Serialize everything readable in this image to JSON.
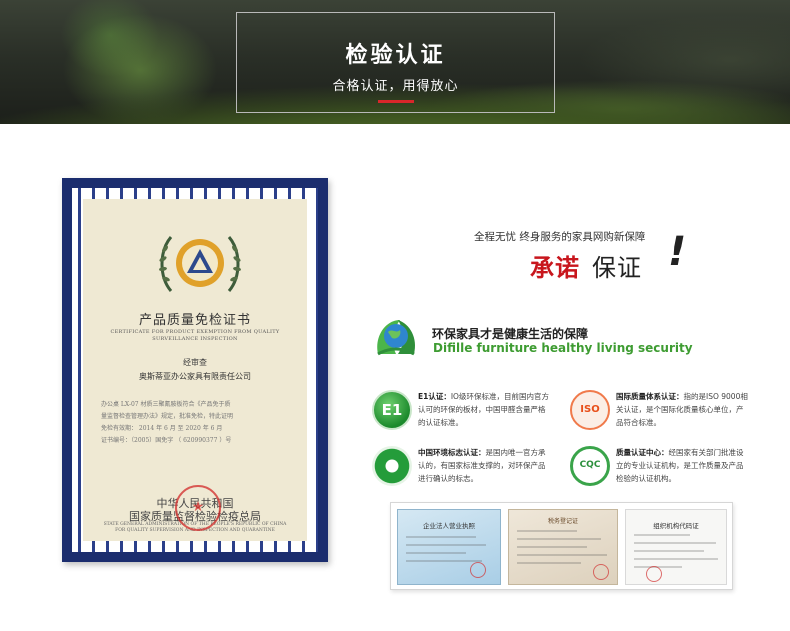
{
  "banner": {
    "title": "检验认证",
    "subtitle": "合格认证，用得放心"
  },
  "certificate": {
    "title": "产品质量免检证书",
    "subtitle_en": "CERTIFICATE FOR PRODUCT EXEMPTION FROM QUALITY SURVEILLANCE INSPECTION",
    "review_label": "经审查",
    "company": "奥斯蒂亚办公家具有限责任公司",
    "body_line1": "办公桌 LX-07 材质三聚氰胺板符合《产品免于质",
    "body_line2": "量监督检查管理办法》规定，批准免检，特此证明",
    "validity": "免检有效期：  2014 年  6 月  至 2020 年  6 月",
    "cert_no": "证书编号：（2005）国免字 （ 620990377 ）号",
    "issuer_cn_1": "中华人民共和国",
    "issuer_cn_2": "国家质量监督检验检疫总局",
    "issuer_en": "STATE GENERAL ADMINISTRATION OF THE PEOPLE'S REPUBLIC OF CHINA FOR QUALITY SUPERVISION AND INSPECTION AND QUARANTINE"
  },
  "promise": {
    "tagline": "全程无忧 终身服务的家具网购新保障",
    "red": "承诺",
    "black": "保证",
    "bang": "!"
  },
  "eco": {
    "cn": "环保家具才是健康生活的保障",
    "en": "Difille  furniture healthy living security"
  },
  "certs": [
    {
      "logo": "E1",
      "icon": "e1-logo-icon",
      "head": "E1认证：",
      "text": "IO级环保标准，目前国内官方认可的环保的板材，中国甲醛含量严格的认证标准。"
    },
    {
      "logo": "ISO",
      "icon": "iso-logo-icon",
      "head": "国际质量体系认证：",
      "text": "指的是ISO 9000相关认证，是个国际化质量核心单位，产品符合标准。"
    },
    {
      "logo": "",
      "icon": "china-environmental-label-icon",
      "head": "中国环境标志认证：",
      "text": "是国内唯一官方承认的，有国家标准支撑的，对环保产品进行确认的标志。"
    },
    {
      "logo": "CQC",
      "icon": "cqc-logo-icon",
      "head": "质量认证中心：",
      "text": "经国家有关部门批准设立的专业认证机构，是工作质量及产品检验的认证机构。"
    }
  ],
  "documents": {
    "license_title": "企业法人营业执照",
    "tax_title": "税务登记证",
    "org_title": "组织机构代码证"
  },
  "colors": {
    "banner_accent": "#d9262a",
    "promise_red": "#c8161d",
    "eco_green": "#3e9c32",
    "cert_border": "#1b2d6e"
  }
}
